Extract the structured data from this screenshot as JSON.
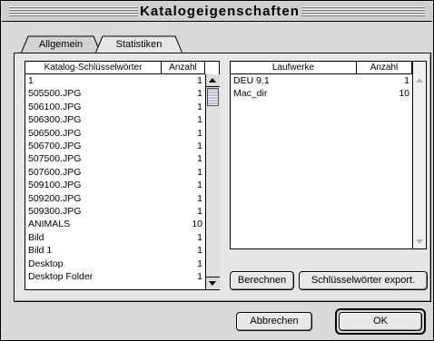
{
  "window": {
    "title": "Katalogeigenschaften"
  },
  "tabs": [
    {
      "label": "Allgemein"
    },
    {
      "label": "Statistiken"
    }
  ],
  "keywords_list": {
    "col_name": "Katalog-Schlüsselwörter",
    "col_count": "Anzahl",
    "rows": [
      {
        "name": "1",
        "count": "1"
      },
      {
        "name": "505500.JPG",
        "count": "1"
      },
      {
        "name": "506100.JPG",
        "count": "1"
      },
      {
        "name": "506300.JPG",
        "count": "1"
      },
      {
        "name": "506500.JPG",
        "count": "1"
      },
      {
        "name": "506700.JPG",
        "count": "1"
      },
      {
        "name": "507500.JPG",
        "count": "1"
      },
      {
        "name": "507600.JPG",
        "count": "1"
      },
      {
        "name": "509100.JPG",
        "count": "1"
      },
      {
        "name": "509200.JPG",
        "count": "1"
      },
      {
        "name": "509300.JPG",
        "count": "1"
      },
      {
        "name": "ANIMALS",
        "count": "10"
      },
      {
        "name": "Bild",
        "count": "1"
      },
      {
        "name": "Bild 1",
        "count": "1"
      },
      {
        "name": "Desktop",
        "count": "1"
      },
      {
        "name": "Desktop Folder",
        "count": "1"
      }
    ]
  },
  "drives_list": {
    "col_name": "Laufwerke",
    "col_count": "Anzahl",
    "rows": [
      {
        "name": "DEU 9.1",
        "count": "1"
      },
      {
        "name": "Mac_dir",
        "count": "10"
      }
    ]
  },
  "buttons": {
    "calculate": "Berechnen",
    "export": "Schlüsselwörter export.",
    "cancel": "Abbrechen",
    "ok": "OK"
  },
  "colors": {
    "window_bg": "#d9d9d9",
    "panel_bg": "#e6e6e6",
    "thumb": "#bfc3d6"
  }
}
